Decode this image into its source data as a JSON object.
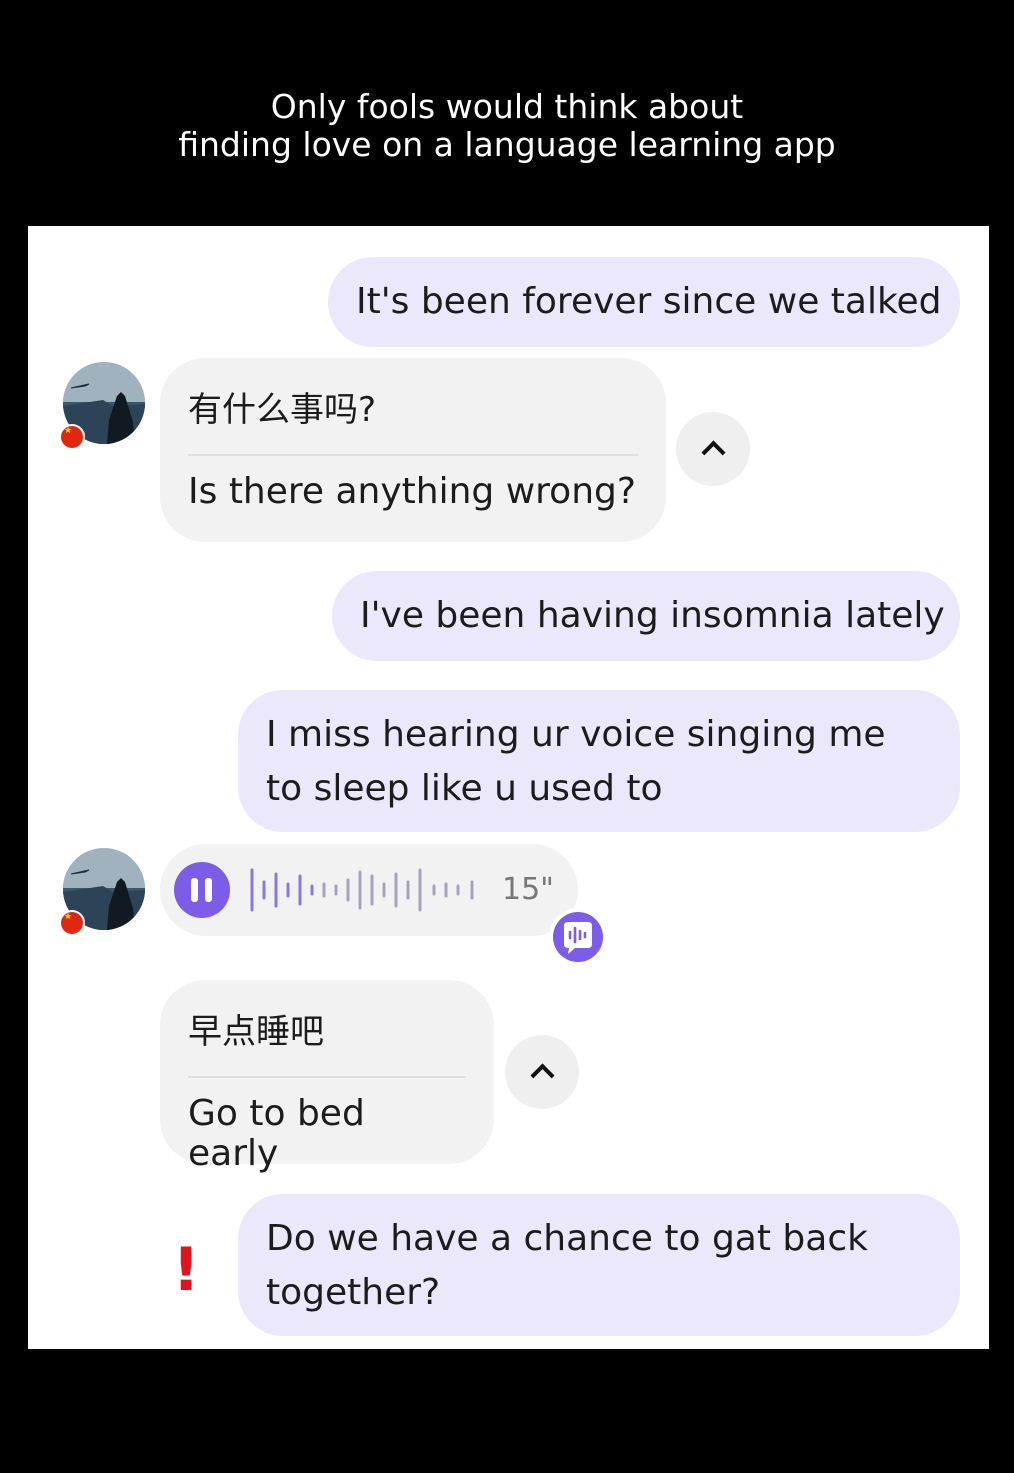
{
  "caption": {
    "line1": "Only fools would think about",
    "line2": "finding love on a language learning app"
  },
  "messages": {
    "m1": {
      "text": "It's been forever since we talked"
    },
    "m2": {
      "original": "有什么事吗?",
      "translation": "Is there anything wrong?"
    },
    "m3": {
      "text": "I've been having insomnia lately"
    },
    "m4": {
      "text": "I miss hearing ur voice singing me to sleep like u used to"
    },
    "m5": {
      "duration": "15\"",
      "state": "playing"
    },
    "m6": {
      "original": "早点睡吧",
      "translation": "Go to bed early"
    },
    "m7": {
      "text": "Do we have a chance to gat back together?",
      "status": "failed"
    }
  },
  "colors": {
    "outgoing_bubble": "#ebe8fb",
    "incoming_bubble": "#f2f2f2",
    "accent": "#7b5de8",
    "error": "#e0141e"
  },
  "icons": {
    "pause": "pause-icon",
    "collapse": "chevron-up-icon",
    "transcribe": "voice-to-text-icon",
    "error": "exclamation-icon",
    "flag": "china-flag-icon"
  }
}
